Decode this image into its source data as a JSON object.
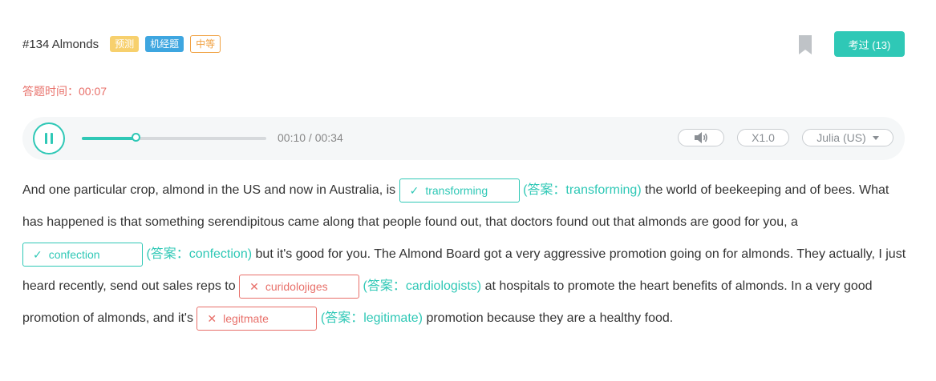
{
  "header": {
    "title": "#134 Almonds",
    "tags": [
      "预测",
      "机经题",
      "中等"
    ],
    "exam_button": "考过 (13)"
  },
  "timer": {
    "label": "答题时间：",
    "value": "00:07"
  },
  "player": {
    "time": "00:10 / 00:34",
    "progress": 0.29,
    "speed": "X1.0",
    "voice": "Julia (US)"
  },
  "passage": {
    "seg1": "And one particular crop, almond in the US and now in Australia, is",
    "seg2": "the world of beekeeping and of bees. What has happened is that something serendipitous came along that people found out, that doctors found out that almonds are good for you, a",
    "seg3": "but it's good for you. The Almond Board got a very aggressive promotion going on for almonds. They actually, I just heard recently, send out sales reps to",
    "seg4": "at hospitals to promote the heart benefits of almonds. In a very good promotion of almonds, and it's",
    "seg5": "promotion because they are a healthy food.",
    "blanks": [
      {
        "user": "transforming",
        "answer": "(答案：transforming)",
        "status": "correct",
        "mark": "✓"
      },
      {
        "user": "confection",
        "answer": "(答案：confection)",
        "status": "correct",
        "mark": "✓"
      },
      {
        "user": "curidolojiges",
        "answer": "(答案：cardiologists)",
        "status": "wrong",
        "mark": "✕"
      },
      {
        "user": "legitmate",
        "answer": "(答案：legitimate)",
        "status": "wrong",
        "mark": "✕"
      }
    ]
  },
  "colors": {
    "accent": "#2fc8b6",
    "error": "#e8706a",
    "tag_predict": "#f7d06d",
    "tag_machine": "#3ea6e0",
    "tag_medium": "#f0a040"
  },
  "icons": {
    "pause": "pause-icon",
    "bookmark": "bookmark-icon",
    "volume": "volume-icon",
    "correct": "check-icon",
    "wrong": "cross-icon",
    "dropdown": "caret-down-icon"
  }
}
